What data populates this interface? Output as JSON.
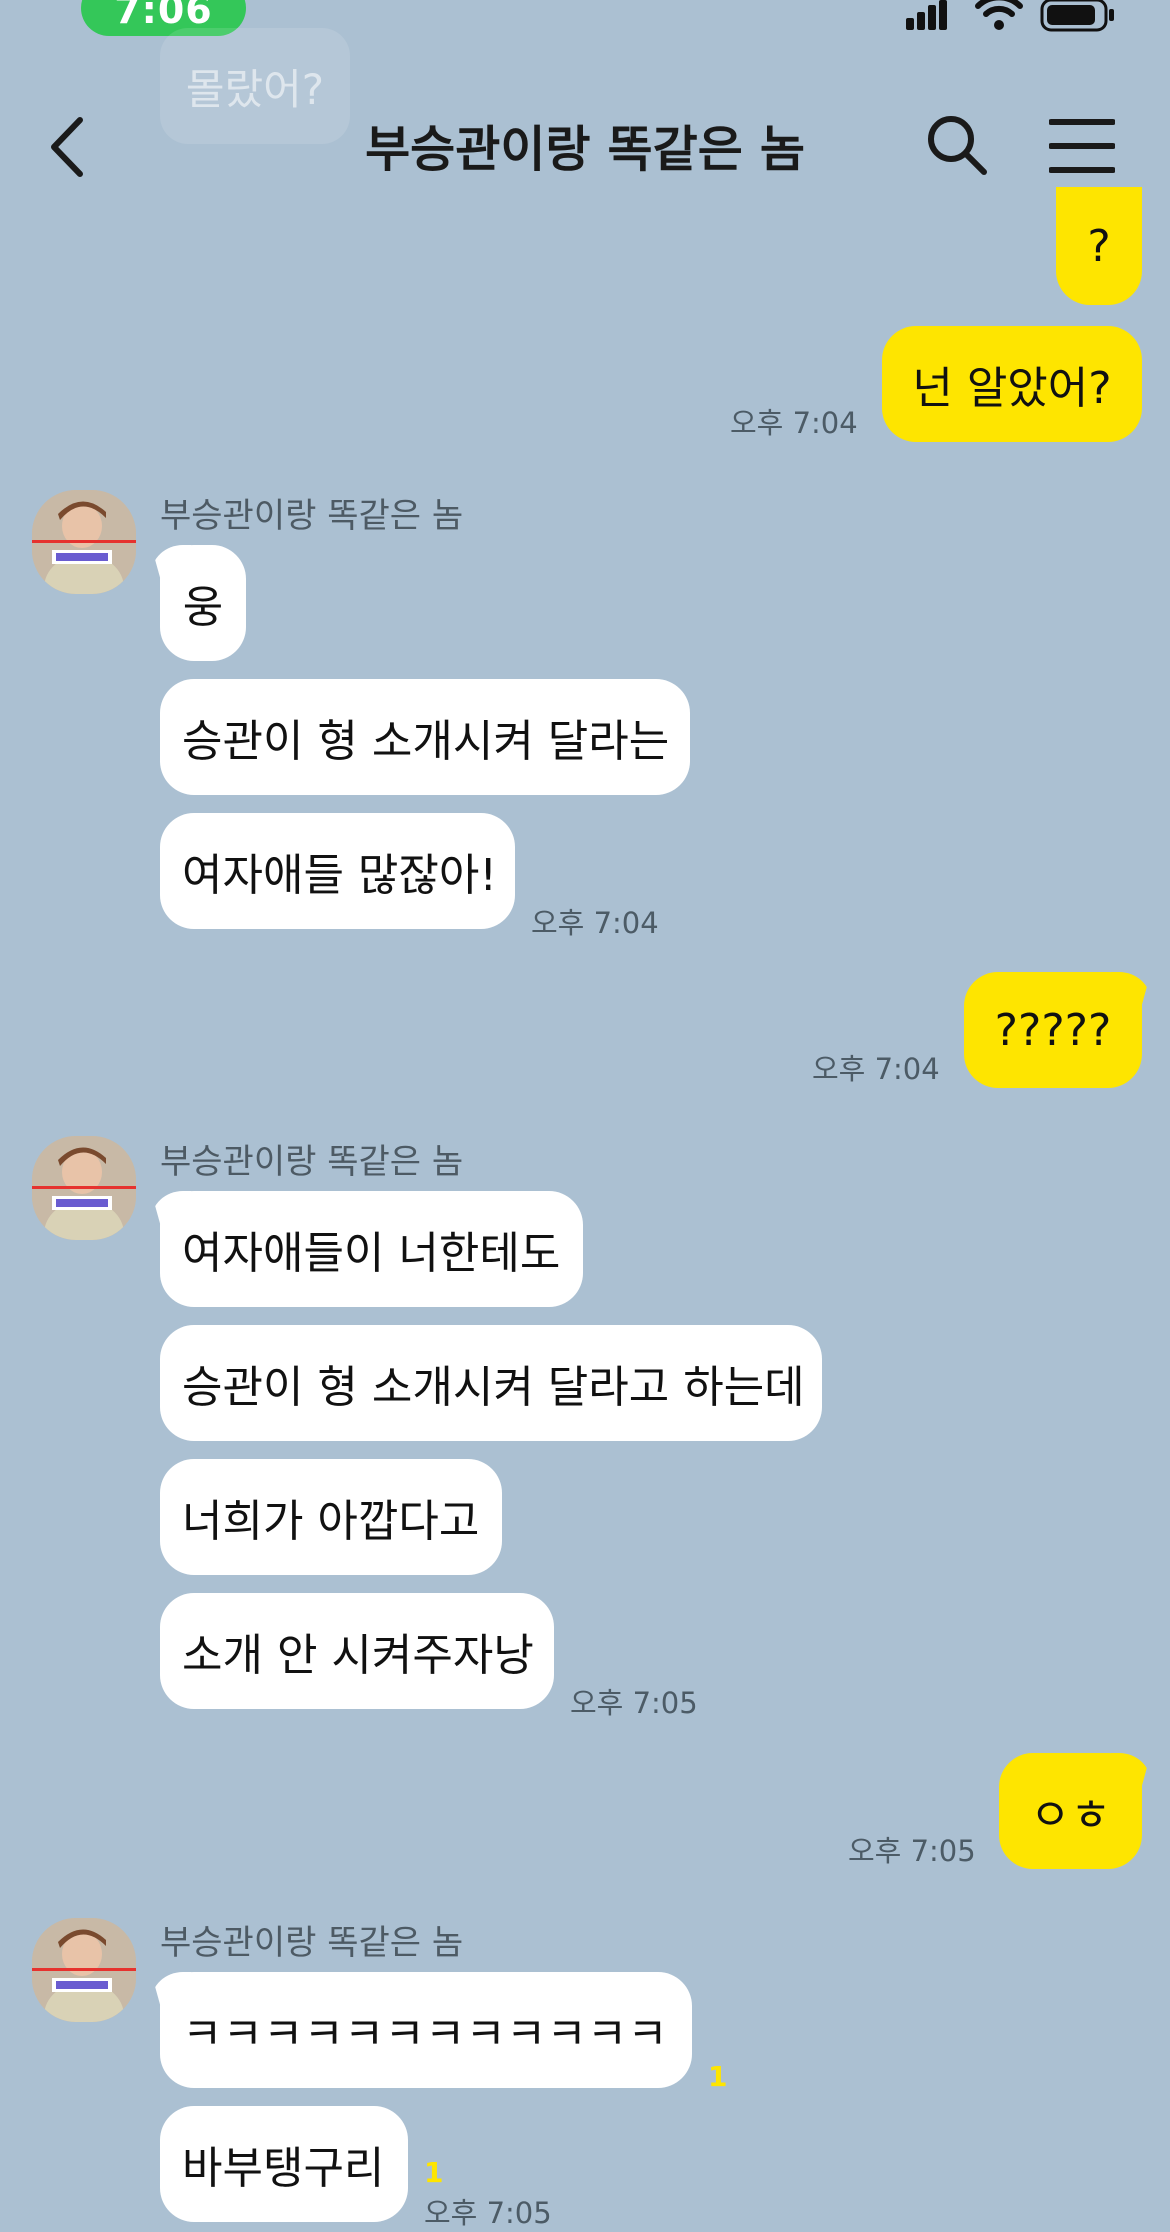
{
  "status_bar": {
    "time": "7:06"
  },
  "header": {
    "title": "부승관이랑 똑같은 놈",
    "icons": [
      "back-arrow-icon",
      "search-icon",
      "menu-icon"
    ]
  },
  "faded_message": "몰랐어?",
  "messages": [
    {
      "side": "out",
      "text": "?"
    },
    {
      "side": "out",
      "text": "넌 알았어?",
      "time": "오후 7:04"
    },
    {
      "side": "in",
      "sender": "부승관이랑 똑같은 놈",
      "text": "웅"
    },
    {
      "side": "in",
      "text": "승관이 형 소개시켜 달라는"
    },
    {
      "side": "in",
      "text": "여자애들 많잖아!",
      "time": "오후 7:04"
    },
    {
      "side": "out",
      "text": "?????",
      "time": "오후 7:04"
    },
    {
      "side": "in",
      "sender": "부승관이랑 똑같은 놈",
      "text": "여자애들이 너한테도"
    },
    {
      "side": "in",
      "text": "승관이 형 소개시켜 달라고 하는데"
    },
    {
      "side": "in",
      "text": "너희가 아깝다고"
    },
    {
      "side": "in",
      "text": "소개 안 시켜주자낭",
      "time": "오후 7:05"
    },
    {
      "side": "out",
      "text": "ㅇㅎ",
      "time": "오후 7:05"
    },
    {
      "side": "in",
      "sender": "부승관이랑 똑같은 놈",
      "text": "ㅋㅋㅋㅋㅋㅋㅋㅋㅋㅋㅋㅋ",
      "unread": "1"
    },
    {
      "side": "in",
      "text": "바부탱구리",
      "unread": "1",
      "time": "오후 7:05"
    }
  ],
  "colors": {
    "background": "#abc0d2",
    "my_bubble": "#fee500",
    "their_bubble": "#ffffff",
    "status_time_pill": "#34c759"
  }
}
